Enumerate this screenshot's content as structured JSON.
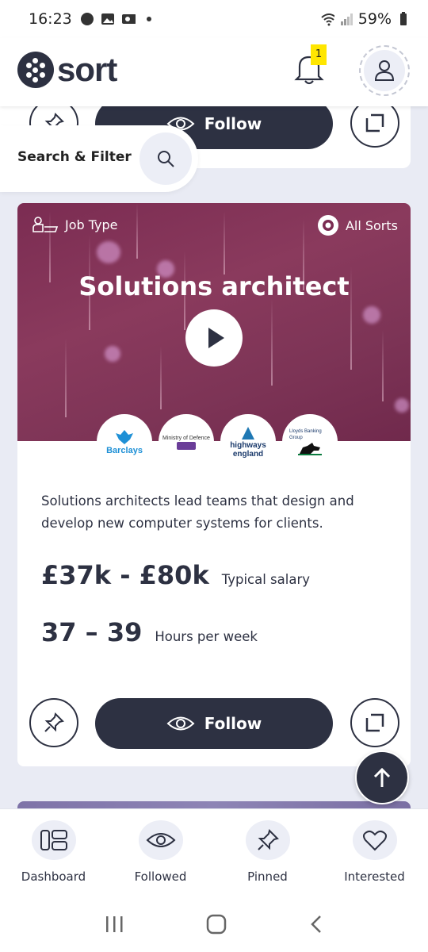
{
  "status_bar": {
    "time": "16:23",
    "battery": "59%"
  },
  "app_bar": {
    "logo_text": "sort",
    "notification_count": "1"
  },
  "search_filter": {
    "label": "Search & Filter"
  },
  "previous_card": {
    "follow_label": "Follow"
  },
  "card": {
    "tag_left": "Job Type",
    "tag_right": "All Sorts",
    "title": "Solutions architect",
    "employers": [
      "Barclays",
      "Ministry of Defence",
      "highways england",
      "Lloyds Banking Group"
    ],
    "description": "Solutions architects lead teams that design and develop new computer systems for clients.",
    "salary_value": "£37k - £80k",
    "salary_label": "Typical salary",
    "hours_value": "37 – 39",
    "hours_label": "Hours per week",
    "follow_label": "Follow"
  },
  "bottom_nav": [
    {
      "label": "Dashboard",
      "icon": "dashboard-icon"
    },
    {
      "label": "Followed",
      "icon": "eye-icon"
    },
    {
      "label": "Pinned",
      "icon": "pin-icon"
    },
    {
      "label": "Interested",
      "icon": "heart-icon"
    }
  ],
  "colors": {
    "brand": "#2d3142",
    "accent": "#ffe600",
    "hero": "#7b2c52"
  }
}
